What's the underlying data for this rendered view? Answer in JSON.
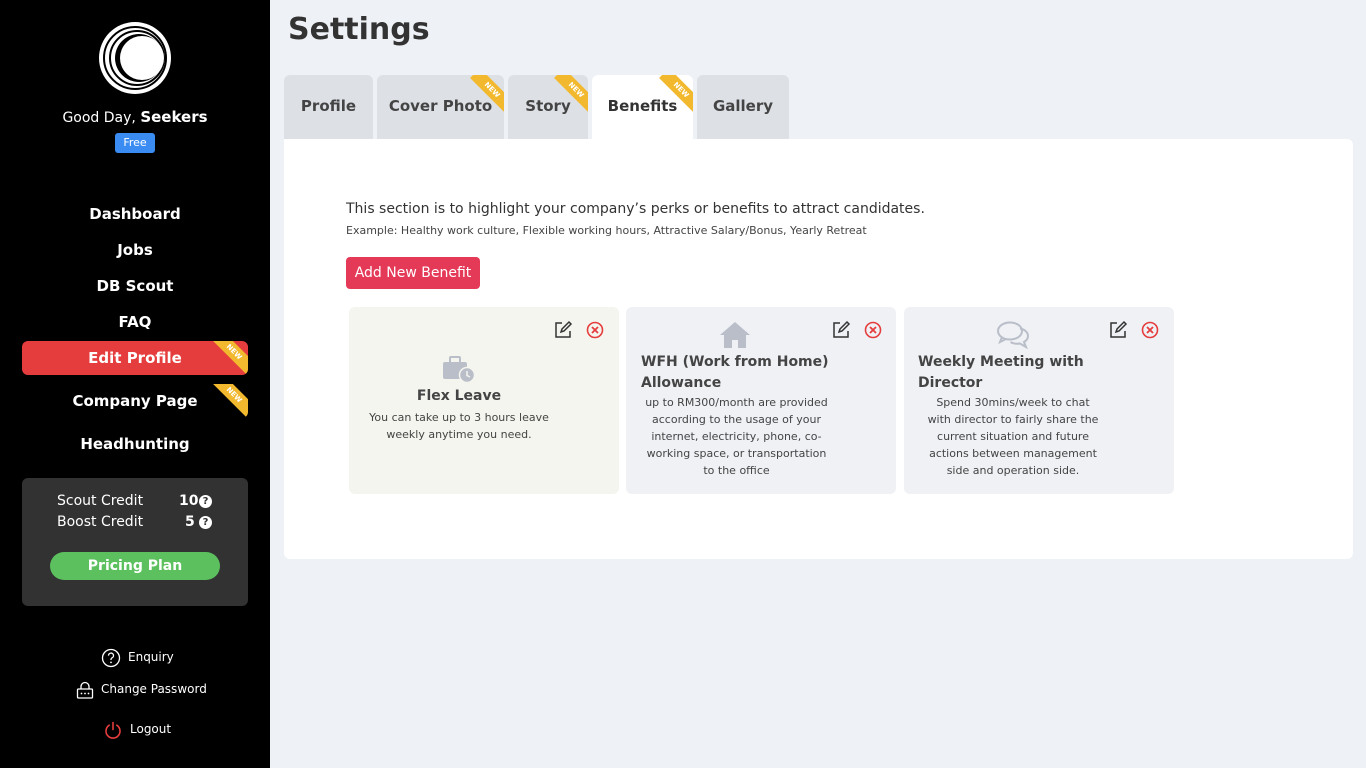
{
  "sidebar": {
    "greeting_prefix": "Good Day, ",
    "user_name": "Seekers",
    "plan": "Free",
    "nav": [
      {
        "label": "Dashboard"
      },
      {
        "label": "Jobs"
      },
      {
        "label": "DB Scout"
      },
      {
        "label": "FAQ"
      },
      {
        "label": "Edit Profile",
        "badge": "NEW"
      },
      {
        "label": "Company Page",
        "badge": "NEW"
      },
      {
        "label": "Headhunting"
      }
    ],
    "credits": [
      {
        "label": "Scout Credit",
        "value": "10"
      },
      {
        "label": "Boost Credit",
        "value": "5"
      }
    ],
    "pricing_button": "Pricing Plan",
    "footer": [
      {
        "label": "Enquiry",
        "icon": "question-circle-icon"
      },
      {
        "label": "Change Password",
        "icon": "lock-icon"
      },
      {
        "label": "Logout",
        "icon": "power-icon"
      }
    ]
  },
  "main": {
    "title": "Settings",
    "tabs": [
      {
        "label": "Profile"
      },
      {
        "label": "Cover Photo",
        "badge": "NEW"
      },
      {
        "label": "Story",
        "badge": "NEW"
      },
      {
        "label": "Benefits",
        "badge": "NEW",
        "active": true
      },
      {
        "label": "Gallery"
      }
    ],
    "intro": "This section is to highlight your company’s perks or benefits to attract candidates.",
    "example": "Example: Healthy work culture, Flexible working hours, Attractive Salary/Bonus, Yearly Retreat",
    "add_button": "Add New Benefit",
    "benefits": [
      {
        "title": "Flex Leave",
        "description": "You can take up to 3 hours leave weekly anytime you need.",
        "icon": "briefcase-clock-icon"
      },
      {
        "title": "WFH (Work from Home) Allowance",
        "description": "up to RM300/month are provided according to the usage of your internet, electricity, phone, co-working space, or transportation to the office",
        "icon": "house-icon"
      },
      {
        "title": "Weekly Meeting with Director",
        "description": "Spend 30mins/week to chat with director to fairly share the current situation and future actions between management side and operation side.",
        "icon": "chat-bubbles-icon"
      }
    ]
  },
  "colors": {
    "sidebar_bg": "#000000",
    "accent_red": "#e53d3d",
    "button_pink": "#e53958",
    "badge_blue": "#3b8cf2",
    "pricing_green": "#5cc05f",
    "ribbon_yellow": "#f2b92e"
  }
}
